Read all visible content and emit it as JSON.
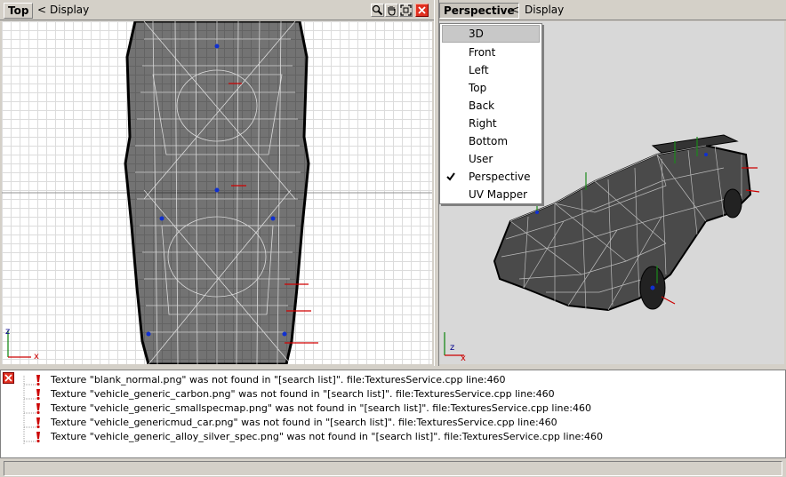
{
  "left_view": {
    "name": "Top",
    "display_label": "Display",
    "toggle_glyph": "<",
    "axes": {
      "vertical": "z",
      "horizontal": "x"
    },
    "toolbar_icons": [
      "zoom-icon",
      "pan-hand-icon",
      "fit-view-icon",
      "close-icon"
    ]
  },
  "right_view": {
    "name": "Perspective",
    "display_label": "Display",
    "toggle_glyph": "<",
    "axes": {
      "vertical": "z",
      "horizontal": "x"
    }
  },
  "view_menu": {
    "items": [
      {
        "label": "3D",
        "highlighted": true,
        "checked": false
      },
      {
        "label": "Front",
        "highlighted": false,
        "checked": false
      },
      {
        "label": "Left",
        "highlighted": false,
        "checked": false
      },
      {
        "label": "Top",
        "highlighted": false,
        "checked": false
      },
      {
        "label": "Back",
        "highlighted": false,
        "checked": false
      },
      {
        "label": "Right",
        "highlighted": false,
        "checked": false
      },
      {
        "label": "Bottom",
        "highlighted": false,
        "checked": false
      },
      {
        "label": "User",
        "highlighted": false,
        "checked": false
      },
      {
        "label": "Perspective",
        "highlighted": false,
        "checked": true
      },
      {
        "label": "UV Mapper",
        "highlighted": false,
        "checked": false
      }
    ]
  },
  "colors": {
    "warning_icon": "#cc0000",
    "close_button": "#e03020",
    "wireframe": "#000000",
    "axis_z": "#1a8a1a",
    "axis_x": "#cc0000"
  },
  "log": {
    "messages": [
      "Texture \"blank_normal.png\" was not found in \"[search list]\". file:TexturesService.cpp line:460",
      "Texture \"vehicle_generic_carbon.png\" was not found in \"[search list]\". file:TexturesService.cpp line:460",
      "Texture \"vehicle_generic_smallspecmap.png\" was not found in \"[search list]\". file:TexturesService.cpp line:460",
      "Texture \"vehicle_genericmud_car.png\" was not found in \"[search list]\". file:TexturesService.cpp line:460",
      "Texture \"vehicle_generic_alloy_silver_spec.png\" was not found in \"[search list]\". file:TexturesService.cpp line:460"
    ]
  }
}
